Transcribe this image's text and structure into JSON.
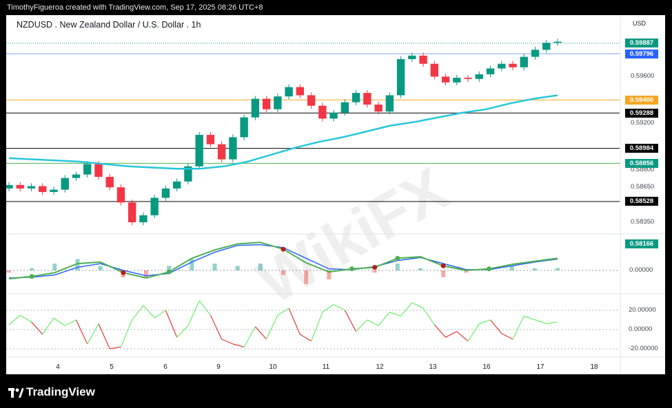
{
  "header": {
    "credit": "TimothyFigueroa created with TradingView.com, Sep 17, 2025 08:26 UTC+8"
  },
  "footer": {
    "brand": "TradingView"
  },
  "chart_data": {
    "type": "line",
    "title": "NZDUSD . New Zealand Dollar / U.S. Dollar . 1h",
    "currency": "USD",
    "x_labels": [
      "4",
      "5",
      "6",
      "9",
      "10",
      "11",
      "12",
      "13",
      "16",
      "17",
      "18"
    ],
    "price_axis": {
      "ylim": [
        0.5825,
        0.5998
      ],
      "tick_labels": [
        "0.59600",
        "0.59200",
        "0.58800",
        "0.58650",
        "0.58350"
      ],
      "tick_values": [
        0.596,
        0.592,
        0.588,
        0.5865,
        0.5835
      ]
    },
    "price_tags": [
      {
        "label": "0.59887",
        "value": 0.59887,
        "bg": "#089981"
      },
      {
        "label": "0.59796",
        "value": 0.59796,
        "bg": "#2962ff"
      },
      {
        "label": "0.59400",
        "value": 0.594,
        "bg": "#f5a623",
        "line": "#f5a623"
      },
      {
        "label": "0.59288",
        "value": 0.59288,
        "bg": "#000000",
        "line": "#000000"
      },
      {
        "label": "0.58984",
        "value": 0.58984,
        "bg": "#000000",
        "line": "#000000"
      },
      {
        "label": "0.58856",
        "value": 0.58856,
        "bg": "#089981",
        "line": "#4caf50"
      },
      {
        "label": "0.58528",
        "value": 0.58528,
        "bg": "#000000",
        "line": "#000000"
      },
      {
        "label": "0.58166",
        "value": 0.58166,
        "bg": "#089981"
      }
    ],
    "price_close": [
      0.5867,
      0.5864,
      0.5866,
      0.5861,
      0.5863,
      0.5873,
      0.5876,
      0.5885,
      0.5874,
      0.5865,
      0.5852,
      0.5835,
      0.5841,
      0.5856,
      0.5864,
      0.587,
      0.5883,
      0.591,
      0.5902,
      0.5889,
      0.5908,
      0.5925,
      0.5941,
      0.5932,
      0.5943,
      0.5951,
      0.5944,
      0.5935,
      0.5924,
      0.5929,
      0.5938,
      0.5946,
      0.5936,
      0.593,
      0.5944,
      0.5975,
      0.5978,
      0.5971,
      0.596,
      0.5955,
      0.5959,
      0.5958,
      0.5962,
      0.5967,
      0.5971,
      0.5968,
      0.5977,
      0.5983,
      0.5989,
      0.599
    ],
    "ma": [
      0.589,
      0.5889,
      0.5888,
      0.5887,
      0.5885,
      0.5883,
      0.5882,
      0.5881,
      0.5881,
      0.5883,
      0.5887,
      0.5893,
      0.5899,
      0.5904,
      0.5908,
      0.5913,
      0.5918,
      0.5921,
      0.5925,
      0.5929,
      0.5932,
      0.5937,
      0.5941,
      0.5944
    ],
    "macd": {
      "zero_label": "0.00000",
      "macd_line": [
        -0.00055,
        -0.0004,
        -0.00015,
        0.00045,
        0.00055,
        -0.00015,
        -0.0005,
        -0.0001,
        0.0008,
        0.00135,
        0.00175,
        0.00185,
        0.0014,
        0.0005,
        -0.0001,
        0.0001,
        0.0002,
        0.0008,
        0.0009,
        0.0003,
        0.0,
        0.0001,
        0.0004,
        0.0006,
        0.0008
      ],
      "signal_line": [
        -0.0005,
        -0.00045,
        -0.0003,
        0.0002,
        0.00045,
        0.0,
        -0.00035,
        -0.0002,
        0.00055,
        0.0012,
        0.00165,
        0.0017,
        0.0015,
        0.0008,
        0.0001,
        5e-05,
        0.00025,
        0.00065,
        0.00085,
        0.00045,
        5e-05,
        5e-05,
        0.0003,
        0.00055,
        0.00075
      ]
    },
    "oscillator": {
      "tick_labels": [
        "20.00000",
        "0.00000",
        "-20.00000"
      ],
      "tick_values": [
        20,
        0,
        -20
      ],
      "values": [
        5,
        15,
        8,
        -5,
        12,
        4,
        10,
        -15,
        6,
        -20,
        -18,
        10,
        25,
        12,
        20,
        -8,
        4,
        30,
        15,
        -10,
        -15,
        -18,
        3,
        -10,
        15,
        22,
        -5,
        -12,
        18,
        26,
        20,
        -2,
        10,
        4,
        18,
        14,
        28,
        22,
        5,
        -8,
        -2,
        -12,
        6,
        10,
        -4,
        -10,
        14,
        10,
        6,
        8
      ]
    }
  }
}
